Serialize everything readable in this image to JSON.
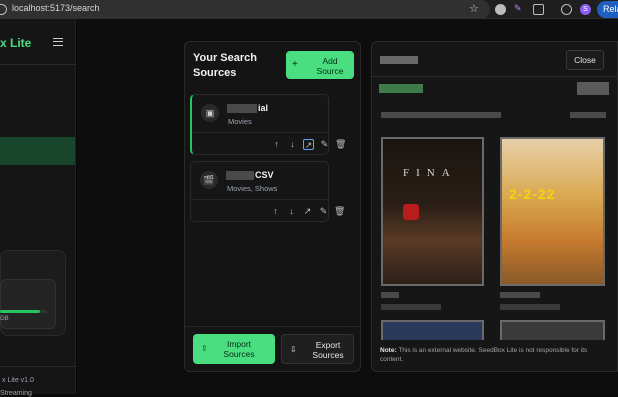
{
  "browser": {
    "url": "localhost:5173/search",
    "profile_initial": "S",
    "relaunch_label": "Relau"
  },
  "sidebar": {
    "brand": "x Lite",
    "storage_size": "GB",
    "storage_progress": 0.85,
    "version": "x Lite v1.0",
    "tagline": "Streaming"
  },
  "sources_panel": {
    "title": "Your Search Sources",
    "add_button": "Add Source",
    "sources": [
      {
        "name_suffix": "ial",
        "categories": "Movies",
        "icon": "tv-icon"
      },
      {
        "name_suffix": "CSV",
        "categories": "Movies, Shows",
        "icon": "clapperboard-icon"
      }
    ],
    "import_button": "Import Sources",
    "export_button": "Export Sources"
  },
  "preview": {
    "close_button": "Close",
    "poster1_text": "FINA",
    "poster2_text": "2-2-22",
    "note_label": "Note:",
    "note_text": "This is an external website. SeedBox Lite is not responsible for its content."
  },
  "colors": {
    "accent": "#4ade80",
    "active_nav": "#17462c",
    "relaunch": "#1f5fbf"
  }
}
